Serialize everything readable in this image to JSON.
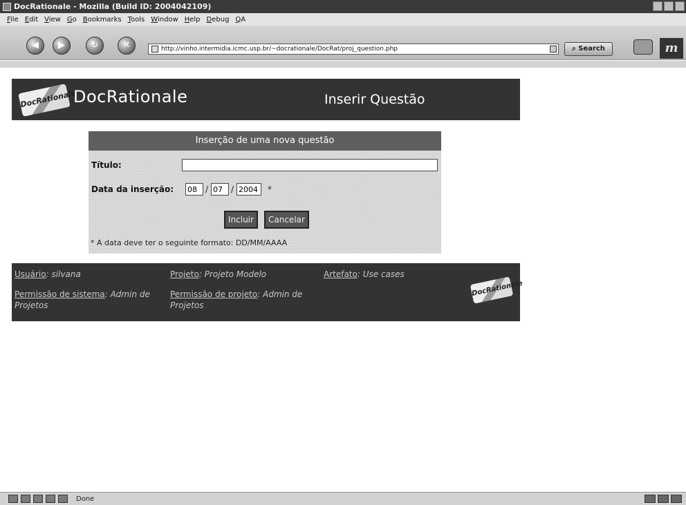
{
  "browser": {
    "window_title": "DocRationale - Mozilla (Build ID: 2004042109)",
    "menu": [
      "File",
      "Edit",
      "View",
      "Go",
      "Bookmarks",
      "Tools",
      "Window",
      "Help",
      "Debug",
      "QA"
    ],
    "url": "http://vinho.intermidia.icmc.usp.br/~docrationale/DocRat/proj_question.php",
    "search_label": "Search",
    "status": "Done"
  },
  "header": {
    "logo_text": "DocRationale",
    "app_title": "DocRationale",
    "page_title": "Inserir Questão"
  },
  "form": {
    "heading": "Inserção de uma nova questão",
    "title_label": "Título:",
    "title_value": "",
    "date_label": "Data da inserção:",
    "day": "08",
    "month": "07",
    "year": "2004",
    "date_sep": "/",
    "required_mark": "*",
    "submit_label": "Incluir",
    "cancel_label": "Cancelar",
    "note": "* A data deve ter o seguinte formato: DD/MM/AAAA"
  },
  "footer": {
    "user_label": "Usuário",
    "user_value": "silvana",
    "project_label": "Projeto",
    "project_value": "Projeto Modelo",
    "artifact_label": "Artefato",
    "artifact_value": "Use cases",
    "sys_perm_label": "Permissão de sistema",
    "sys_perm_value": "Admin de Projetos",
    "proj_perm_label": "Permissão de projeto",
    "proj_perm_value": "Admin de Projetos",
    "logo_text": "DocRationale"
  }
}
